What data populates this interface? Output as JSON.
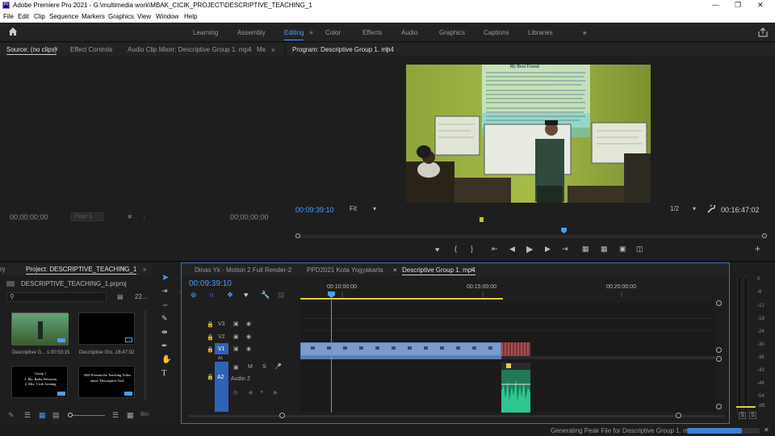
{
  "app": {
    "title": "Adobe Premiere Pro 2021 - G:\\multimedia work\\MBAK_CICIK_PROJECT\\DESCRIPTIVE_TEACHING_1",
    "logo_text": "Pr"
  },
  "menu": [
    "File",
    "Edit",
    "Clip",
    "Sequence",
    "Markers",
    "Graphics",
    "View",
    "Window",
    "Help"
  ],
  "workspaces": [
    "Learning",
    "Assembly",
    "Editing",
    "Color",
    "Effects",
    "Audio",
    "Graphics",
    "Captions",
    "Libraries"
  ],
  "active_workspace": "Editing",
  "source_panel": {
    "tabs": [
      "Source: (no clips)",
      "Effect Controls",
      "Audio Clip Mixer: Descriptive Group 1. mp4",
      "Me"
    ],
    "timecode_left": "00;00;00;00",
    "timecode_right": "00;00;00;00",
    "page_label": "Page 1"
  },
  "program_panel": {
    "tab": "Program: Descriptive Group 1. mp4",
    "timecode": "00:09:39:10",
    "zoom": "Fit",
    "resolution": "1/2",
    "duration": "00:16:47:02",
    "slide_title": "My Best Friend"
  },
  "project_panel": {
    "tab_prefix": "ry",
    "tab": "Project: DESCRIPTIVE_TEACHING_1",
    "file": "DESCRIPTIVE_TEACHING_1.prproj",
    "item_count": "22...",
    "items": [
      {
        "name": "Descriptive G...",
        "duration": "1:00:53:15"
      },
      {
        "name": "Descriptive Gro...",
        "duration": "16:47:02"
      },
      {
        "name": "",
        "duration": "",
        "title_line1": "Group 1",
        "title_line2": "1. Ms. Rafiq Setiawan",
        "title_line3": "2. Mrs. Cicik Lintang"
      },
      {
        "name": "",
        "duration": "",
        "title_line1": "Will Present the Teaching Video",
        "title_line2": "about 'Descriptive Text'"
      }
    ],
    "footer_label": "Bin"
  },
  "timeline": {
    "tabs": [
      "Dinas Yk - Motion 2 Full Render-2",
      "PPD2021 Kota Yogyakarta",
      "Descriptive Group 1. mp4"
    ],
    "timecode": "00:09:39:10",
    "ruler": [
      "00:10:00:00",
      "00:15:00:00",
      "00:20:00:00"
    ],
    "tracks": [
      "V3",
      "V2",
      "V1",
      "A1",
      "A2"
    ],
    "audio_track_name": "Audio 2",
    "mute": "M",
    "solo": "S"
  },
  "meter": {
    "scale": [
      "0",
      "-6",
      "-12",
      "-18",
      "-24",
      "-30",
      "-36",
      "-42",
      "-48",
      "-54",
      "dB"
    ],
    "solo_left": "S",
    "solo_right": "S"
  },
  "status": {
    "text": "Generating Peak File for Descriptive Group 1. mp4...",
    "progress": 0.75
  },
  "colors": {
    "accent": "#4d9cff",
    "video_clip": "#7b9ad0",
    "audio_clip": "#29c48a",
    "playhead": "#4d9cff",
    "work_area": "#e6d22a"
  }
}
